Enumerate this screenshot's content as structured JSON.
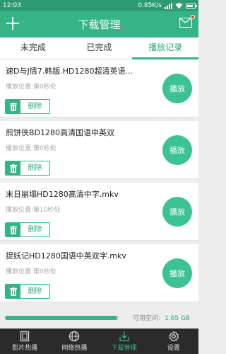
{
  "status": {
    "time": "12:03",
    "net_speed": "0.85K/s"
  },
  "header": {
    "title": "下载管理"
  },
  "tabs": [
    {
      "label": "未完成"
    },
    {
      "label": "已完成"
    },
    {
      "label": "播放记录"
    }
  ],
  "items": [
    {
      "name": "速D与J情7.韩版.HD1280超清英语...",
      "position": "播放位置:第0秒处",
      "delete_label": "删除",
      "play_label": "播放"
    },
    {
      "name": "煎饼侠BD1280高清国语中英双",
      "position": "播放位置:第0秒处",
      "delete_label": "删除",
      "play_label": "播放"
    },
    {
      "name": "末日崩塌HD1280高清中字.mkv",
      "position": "播放位置:第10秒处",
      "delete_label": "删除",
      "play_label": "播放"
    },
    {
      "name": "捉妖记HD1280国语中英双字.mkv",
      "position": "播放位置:第0秒处",
      "delete_label": "删除",
      "play_label": "播放"
    }
  ],
  "storage": {
    "label": "可用空间：",
    "value": "1.65 GB",
    "used_fraction": 0.98
  },
  "nav": [
    {
      "label": "影片热播",
      "icon": "film-icon"
    },
    {
      "label": "网络热播",
      "icon": "globe-icon"
    },
    {
      "label": "下载管理",
      "icon": "download-icon"
    },
    {
      "label": "设置",
      "icon": "gear-icon"
    }
  ],
  "colors": {
    "primary": "#35b587",
    "status_bar": "#2f9b72",
    "nav_bg": "#2b2b2b"
  }
}
